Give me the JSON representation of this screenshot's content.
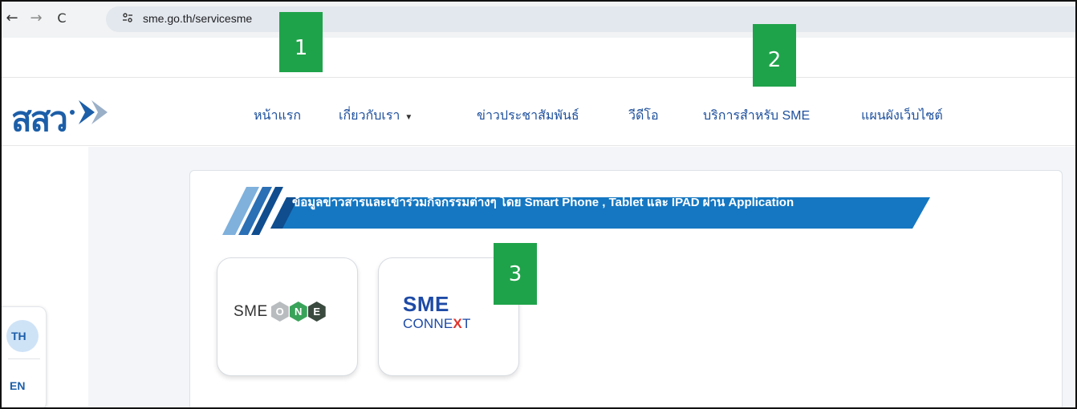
{
  "browser": {
    "back_glyph": "←",
    "forward_glyph": "→",
    "reload_glyph": "C",
    "site_info_glyph": "⚲",
    "url": "sme.go.th/servicesme"
  },
  "header": {
    "logo_text": "สสว",
    "menu": [
      {
        "label": "หน้าแรก"
      },
      {
        "label": "เกี่ยวกับเรา",
        "caret": "▼"
      },
      {
        "label": "ข่าวประชาสัมพันธ์"
      },
      {
        "label": "วีดีโอ"
      },
      {
        "label": "บริการสำหรับ SME"
      },
      {
        "label": "แผนผังเว็บไซต์"
      }
    ]
  },
  "language": {
    "th": "TH",
    "en": "EN"
  },
  "content": {
    "banner_text": "ข้อมูลข่าวสารและเข้าร่วมกิจกรรมต่างๆ โดย Smart Phone , Tablet และ IPAD ผ่าน Application",
    "apps": {
      "sme_one": {
        "prefix": "SME",
        "letters": [
          "O",
          "N",
          "E"
        ]
      },
      "sme_connext": {
        "line1": "SME",
        "line2_main": "CONNE",
        "line2_x": "X",
        "line2_end": "T"
      }
    }
  },
  "markers": [
    "1",
    "2",
    "3"
  ],
  "colors": {
    "brand_blue": "#1c5ea8",
    "banner_blue": "#1577c2",
    "marker_green": "#1fa34a",
    "hex_gray": "#b8bcbf",
    "hex_dark": "#3a4a3e",
    "hex_green": "#3aa35a",
    "connext_red": "#e0322b"
  }
}
